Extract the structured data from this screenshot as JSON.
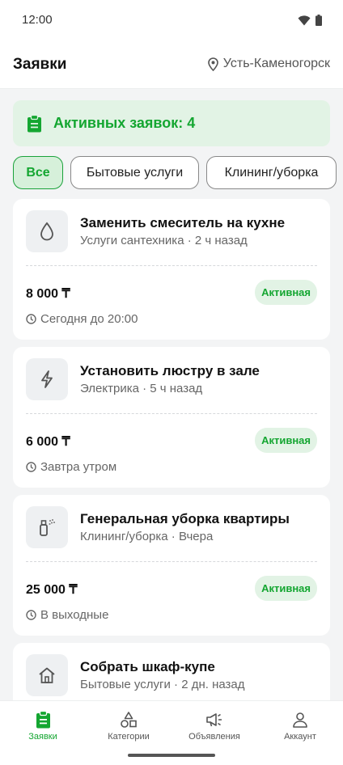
{
  "status_bar": {
    "time": "12:00",
    "icons": [
      "wifi-icon",
      "battery-icon"
    ]
  },
  "header": {
    "title": "Заявки",
    "location": "Усть-Каменогорск",
    "location_icon": "location-pin-icon"
  },
  "banner": {
    "icon": "clipboard-icon",
    "text": "Активных заявок: 4"
  },
  "filters": [
    {
      "label": "Все",
      "selected": true
    },
    {
      "label": "Бытовые услуги",
      "selected": false
    },
    {
      "label": "Клининг/уборка",
      "selected": false
    }
  ],
  "requests": [
    {
      "icon": "water-drop-icon",
      "title": "Заменить смеситель на кухне",
      "subtitle": "Услуги сантехника · 2 ч назад",
      "price": "8 000 ₸",
      "status": "Активная",
      "time": "Сегодня до 20:00"
    },
    {
      "icon": "lightning-icon",
      "title": "Установить люстру в зале",
      "subtitle": "Электрика · 5 ч назад",
      "price": "6 000 ₸",
      "status": "Активная",
      "time": "Завтра утром"
    },
    {
      "icon": "spray-bottle-icon",
      "title": "Генеральная уборка квартиры",
      "subtitle": "Клининг/уборка · Вчера",
      "price": "25 000 ₸",
      "status": "Активная",
      "time": "В выходные"
    },
    {
      "icon": "house-icon",
      "title": "Собрать шкаф-купе",
      "subtitle": "Бытовые услуги · 2 дн. назад"
    }
  ],
  "bottom_nav": [
    {
      "label": "Заявки",
      "icon": "clipboard-icon",
      "active": true
    },
    {
      "label": "Категории",
      "icon": "shapes-icon",
      "active": false
    },
    {
      "label": "Объявления",
      "icon": "megaphone-icon",
      "active": false
    },
    {
      "label": "Аккаунт",
      "icon": "person-icon",
      "active": false
    }
  ],
  "colors": {
    "accent": "#14a631",
    "accent_bg": "#e2f3e5",
    "background": "#f3f4f5"
  }
}
